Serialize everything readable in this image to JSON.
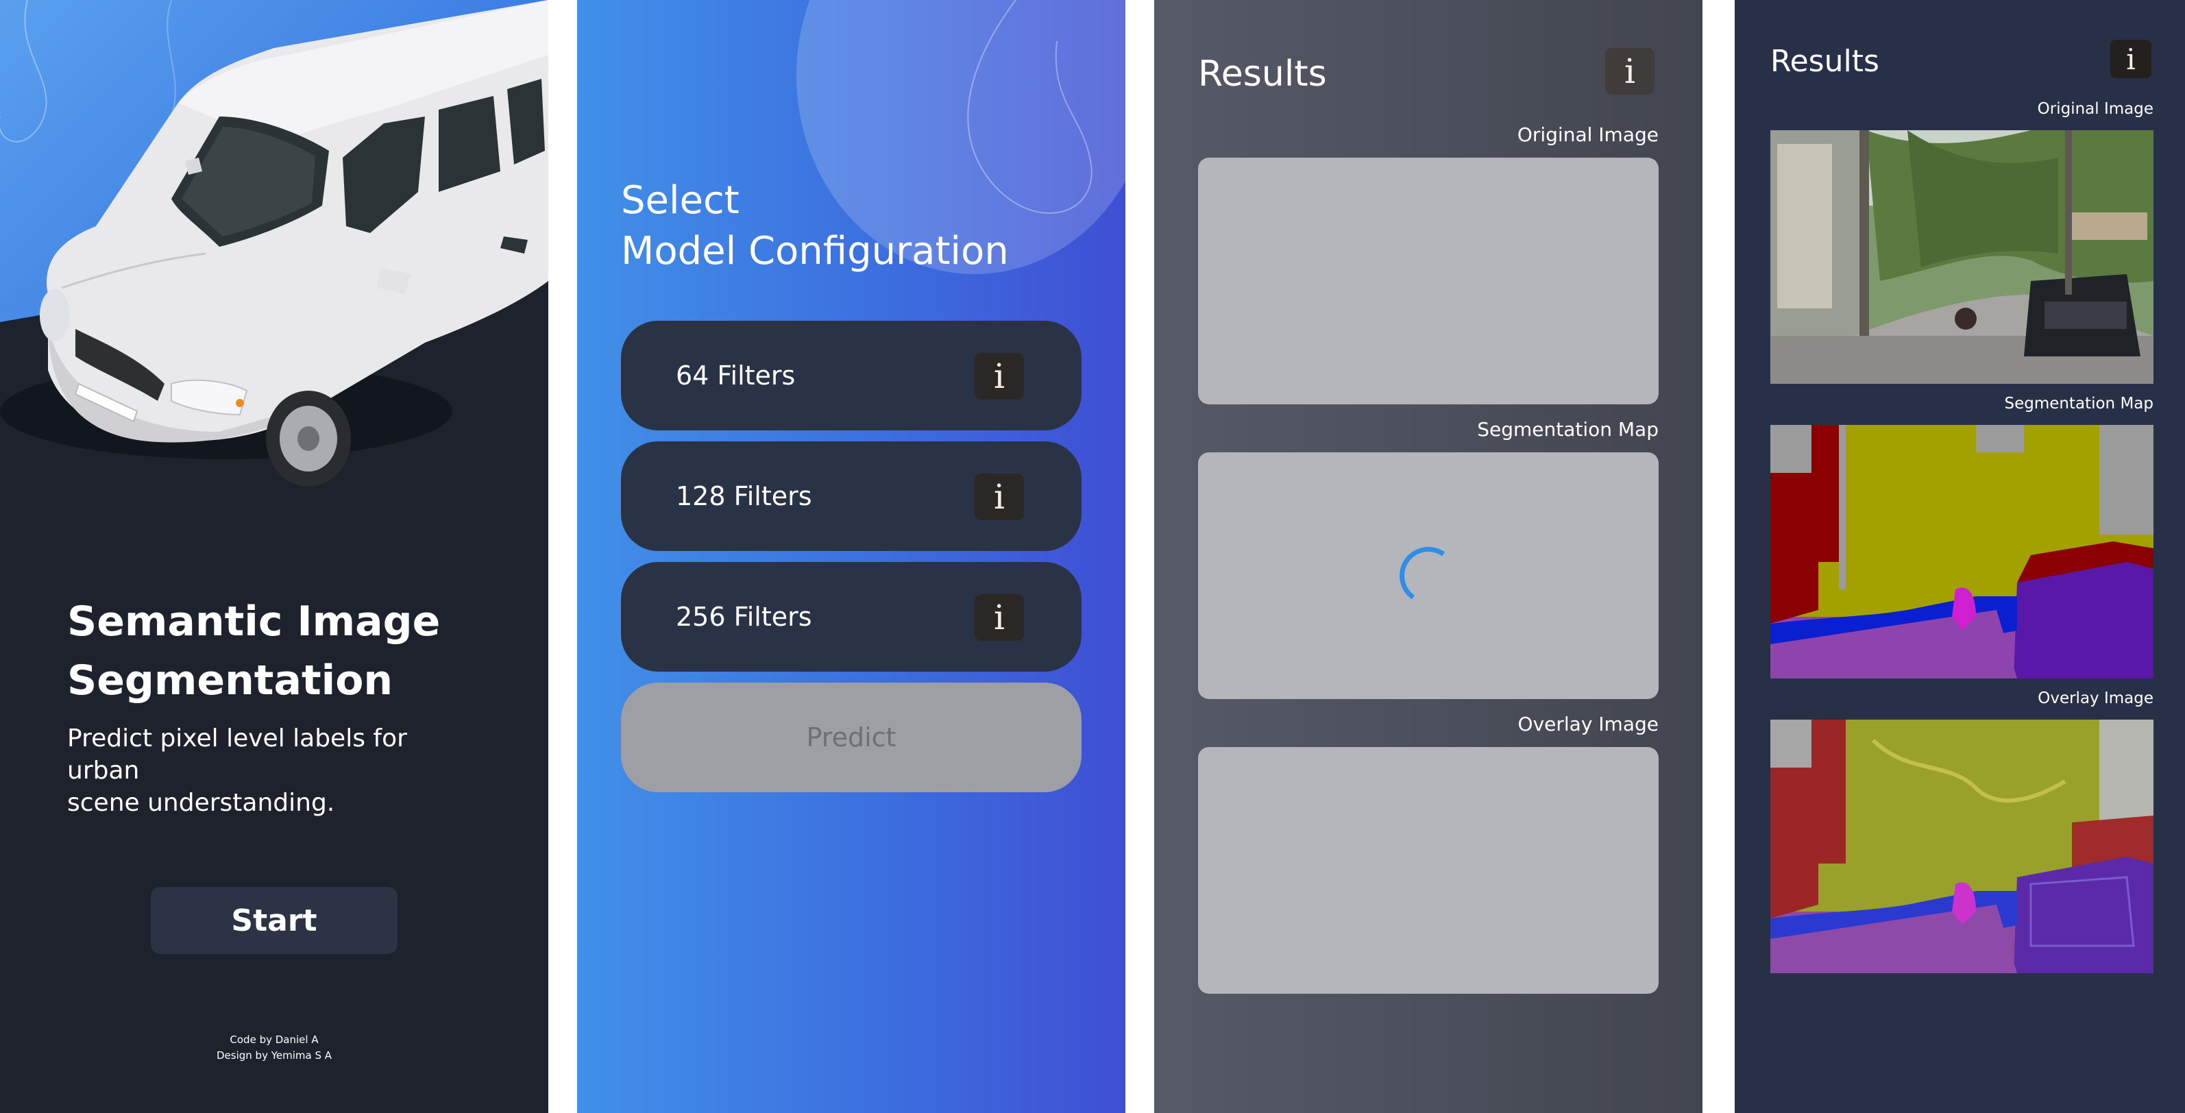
{
  "welcome": {
    "title_line1": "Semantic Image",
    "title_line2": "Segmentation",
    "subtitle_line1": "Predict pixel level labels for urban",
    "subtitle_line2": "scene understanding.",
    "start_label": "Start",
    "credit_code": "Code by Daniel A",
    "credit_design": "Design by Yemima S A"
  },
  "config": {
    "heading_line1": "Select",
    "heading_line2": "Model Configuration",
    "options": [
      {
        "label": "64 Filters",
        "info_icon": "i"
      },
      {
        "label": "128 Filters",
        "info_icon": "i"
      },
      {
        "label": "256 Filters",
        "info_icon": "i"
      }
    ],
    "predict_label": "Predict"
  },
  "results_loading": {
    "title": "Results",
    "info_icon": "i",
    "captions": [
      "Original Image",
      "Segmentation Map",
      "Overlay Image"
    ],
    "status": "loading"
  },
  "results_done": {
    "title": "Results",
    "info_icon": "i",
    "captions": [
      "Original Image",
      "Segmentation Map",
      "Overlay Image"
    ],
    "segmentation_colors": {
      "sky": "#9b9b9b",
      "building": "#8b0000",
      "vegetation": "#a3a100",
      "road": "#8e44ad",
      "sidewalk": "#0a1fcf",
      "car": "#5a18a8",
      "person": "#d01fd0"
    }
  },
  "colors": {
    "welcome_bg": "#1d222d",
    "hero_blue": "#3d7fe3",
    "button_dark": "#2a3345",
    "config_gradient_start": "#4190e8",
    "config_gradient_end": "#3f4fd4",
    "predict_disabled": "#9d9fa5",
    "results_bg": "#4b4f5b",
    "placeholder": "#b4b6bb",
    "spinner": "#2f8fe6",
    "results_done_bg": "#283047"
  }
}
